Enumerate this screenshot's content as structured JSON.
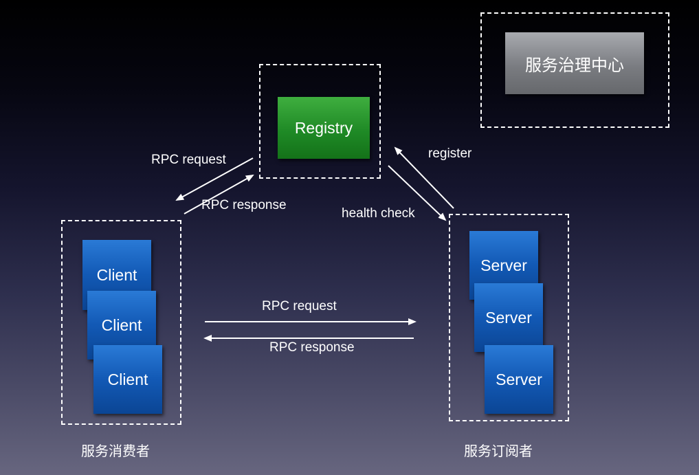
{
  "nodes": {
    "governance": "服务治理中心",
    "registry": "Registry",
    "clients": [
      "Client",
      "Client",
      "Client"
    ],
    "servers": [
      "Server",
      "Server",
      "Server"
    ]
  },
  "edges": {
    "client_to_registry_request": "RPC request",
    "registry_to_client_response": "RPC response",
    "server_register": "register",
    "registry_health_check": "health check",
    "client_to_server_request": "RPC request",
    "server_to_client_response": "RPC response"
  },
  "groups": {
    "consumer_caption": "服务消费者",
    "provider_caption": "服务订阅者"
  },
  "colors": {
    "client_box": "#1259b5",
    "server_box": "#1259b5",
    "registry_box": "#1f8a26",
    "governance_box": "#7a7c81",
    "arrow": "#ffffff"
  }
}
